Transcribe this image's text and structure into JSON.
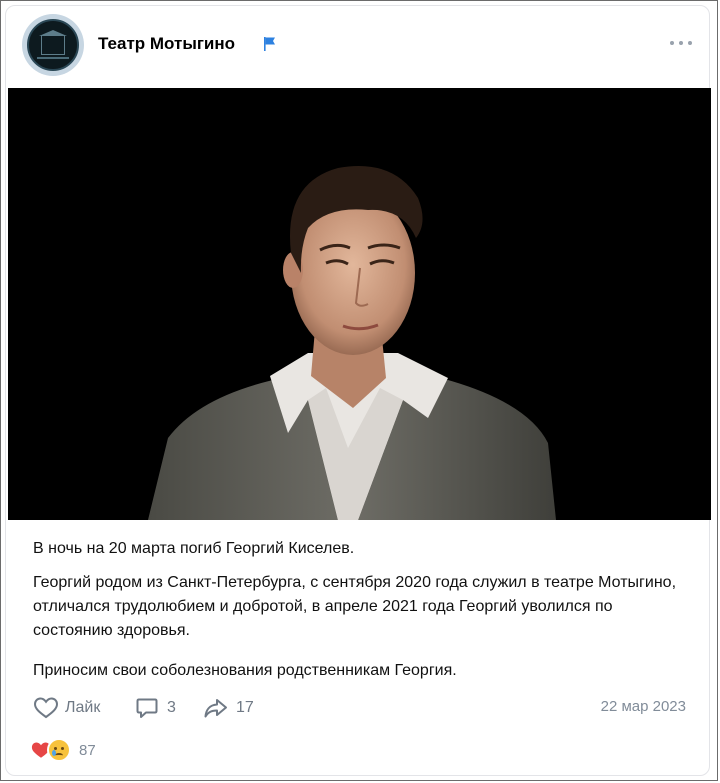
{
  "post": {
    "author": "Театр Мотыгино",
    "date": "22 мар 2023",
    "paragraphs": [
      "В ночь на 20 марта погиб Георгий Киселев.",
      "Георгий родом из Санкт-Петербурга, с сентября 2020 года служил в театре Мотыгино, отличался трудолюбием и добротой, в апреле 2021 года Георгий уволился по состоянию здоровья.",
      "Приносим свои соболезнования родственникам Георгия."
    ]
  },
  "actions": {
    "like_label": "Лайк",
    "comments_count": "3",
    "shares_count": "17"
  },
  "reactions": {
    "count": "87",
    "icons": [
      "heart-icon",
      "crying-face-icon"
    ]
  },
  "icons": {
    "verified": "flag-icon",
    "more": "more-icon",
    "like": "heart-outline-icon",
    "comment": "comment-icon",
    "share": "share-icon"
  },
  "colors": {
    "accent": "#2d81e0",
    "muted": "#818c99",
    "heart": "#e64646"
  }
}
